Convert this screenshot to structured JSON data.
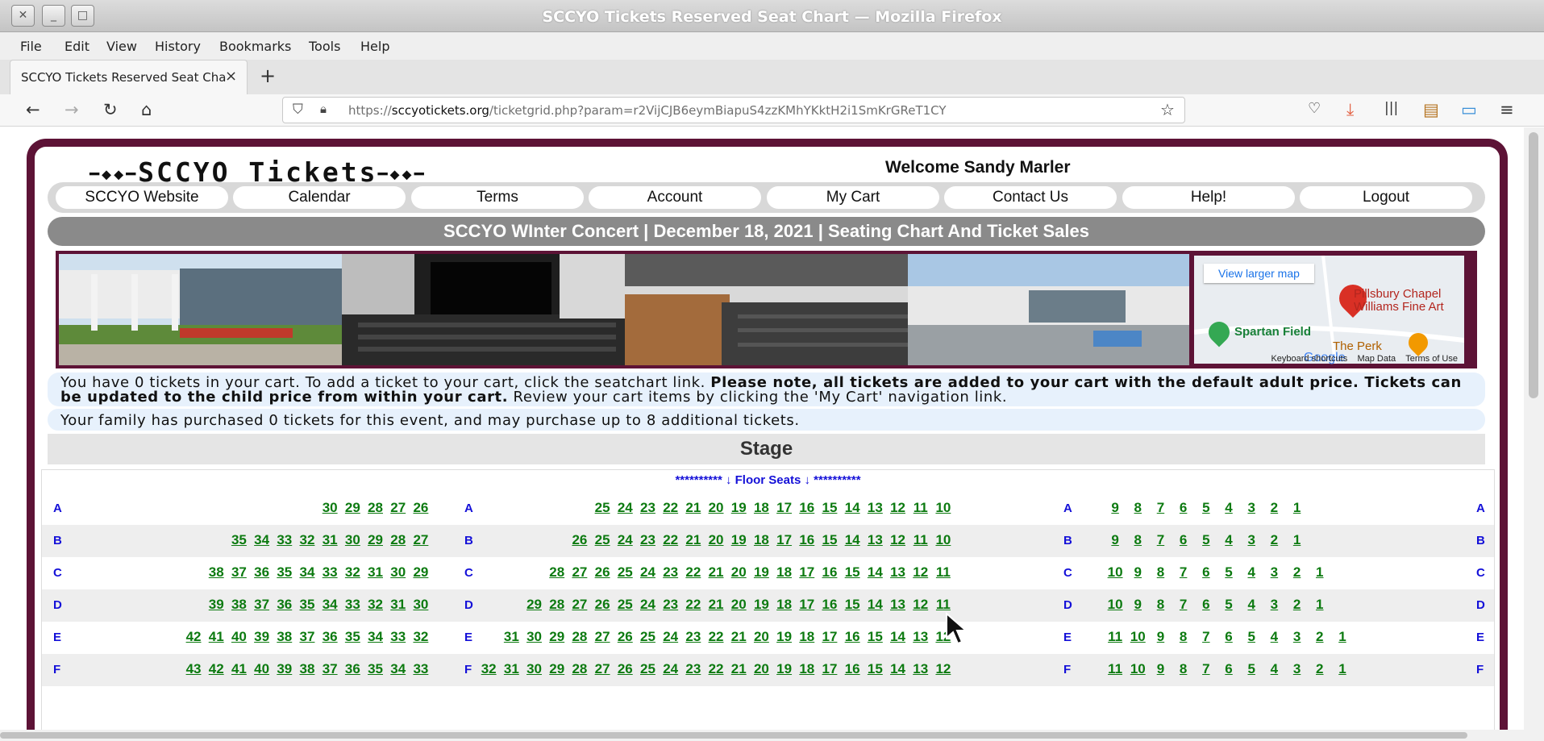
{
  "window": {
    "title": "SCCYO Tickets Reserved Seat Chart — Mozilla Firefox"
  },
  "menu": [
    "File",
    "Edit",
    "View",
    "History",
    "Bookmarks",
    "Tools",
    "Help"
  ],
  "tab": {
    "title": "SCCYO Tickets Reserved Seat Chart",
    "close": "×",
    "new": "+"
  },
  "url": {
    "scheme": "https://",
    "host": "sccyotickets.org",
    "path": "/ticketgrid.php?param=r2VijCJB6eymBiapuS4zzKMhYKktH2i1SmKrGReT1CY"
  },
  "site": {
    "logo": "SCCYO Tickets",
    "welcome": "Welcome Sandy Marler"
  },
  "nav": [
    "SCCYO Website",
    "Calendar",
    "Terms",
    "Account",
    "My Cart",
    "Contact Us",
    "Help!",
    "Logout"
  ],
  "event": "SCCYO WInter Concert | December 18, 2021 | Seating Chart And Ticket Sales",
  "map": {
    "view_larger": "View larger map",
    "place1": "Pillsbury Chapel",
    "place2": "Williams Fine Art",
    "field": "Spartan Field",
    "perk": "The Perk",
    "google": "Google",
    "kbd": "Keyboard shortcuts",
    "mapdata": "Map Data",
    "terms": "Terms of Use"
  },
  "cart": {
    "pre": "You have 0 tickets in your cart. To add a ticket to your cart, click the seatchart link. ",
    "bold": "Please note, all tickets are added to your cart with the default adult price. Tickets can be updated to the child price from within your cart.",
    "post": " Review your cart items by clicking the 'My Cart' navigation link."
  },
  "family": "Your family has purchased 0 tickets for this event, and may purchase up to 8 additional tickets.",
  "stage": "Stage",
  "floor_header": "********** ↓ Floor Seats ↓ **********",
  "rows": [
    {
      "label": "A",
      "left": [
        "30",
        "29",
        "28",
        "27",
        "26"
      ],
      "center": [
        "25",
        "24",
        "23",
        "22",
        "21",
        "20",
        "19",
        "18",
        "17",
        "16",
        "15",
        "14",
        "13",
        "12",
        "11",
        "10"
      ],
      "right": [
        "9",
        "8",
        "7",
        "6",
        "5",
        "4",
        "3",
        "2",
        "1"
      ]
    },
    {
      "label": "B",
      "left": [
        "35",
        "34",
        "33",
        "32",
        "31",
        "30",
        "29",
        "28",
        "27"
      ],
      "center": [
        "26",
        "25",
        "24",
        "23",
        "22",
        "21",
        "20",
        "19",
        "18",
        "17",
        "16",
        "15",
        "14",
        "13",
        "12",
        "11",
        "10"
      ],
      "right": [
        "9",
        "8",
        "7",
        "6",
        "5",
        "4",
        "3",
        "2",
        "1"
      ]
    },
    {
      "label": "C",
      "left": [
        "38",
        "37",
        "36",
        "35",
        "34",
        "33",
        "32",
        "31",
        "30",
        "29"
      ],
      "center": [
        "28",
        "27",
        "26",
        "25",
        "24",
        "23",
        "22",
        "21",
        "20",
        "19",
        "18",
        "17",
        "16",
        "15",
        "14",
        "13",
        "12",
        "11"
      ],
      "right": [
        "10",
        "9",
        "8",
        "7",
        "6",
        "5",
        "4",
        "3",
        "2",
        "1"
      ]
    },
    {
      "label": "D",
      "left": [
        "39",
        "38",
        "37",
        "36",
        "35",
        "34",
        "33",
        "32",
        "31",
        "30"
      ],
      "center": [
        "29",
        "28",
        "27",
        "26",
        "25",
        "24",
        "23",
        "22",
        "21",
        "20",
        "19",
        "18",
        "17",
        "16",
        "15",
        "14",
        "13",
        "12",
        "11"
      ],
      "right": [
        "10",
        "9",
        "8",
        "7",
        "6",
        "5",
        "4",
        "3",
        "2",
        "1"
      ]
    },
    {
      "label": "E",
      "left": [
        "42",
        "41",
        "40",
        "39",
        "38",
        "37",
        "36",
        "35",
        "34",
        "33",
        "32"
      ],
      "center": [
        "31",
        "30",
        "29",
        "28",
        "27",
        "26",
        "25",
        "24",
        "23",
        "22",
        "21",
        "20",
        "19",
        "18",
        "17",
        "16",
        "15",
        "14",
        "13",
        "12"
      ],
      "right": [
        "11",
        "10",
        "9",
        "8",
        "7",
        "6",
        "5",
        "4",
        "3",
        "2",
        "1"
      ]
    },
    {
      "label": "F",
      "left": [
        "43",
        "42",
        "41",
        "40",
        "39",
        "38",
        "37",
        "36",
        "35",
        "34",
        "33"
      ],
      "center": [
        "32",
        "31",
        "30",
        "29",
        "28",
        "27",
        "26",
        "25",
        "24",
        "23",
        "22",
        "21",
        "20",
        "19",
        "18",
        "17",
        "16",
        "15",
        "14",
        "13",
        "12"
      ],
      "right": [
        "11",
        "10",
        "9",
        "8",
        "7",
        "6",
        "5",
        "4",
        "3",
        "2",
        "1"
      ]
    }
  ]
}
